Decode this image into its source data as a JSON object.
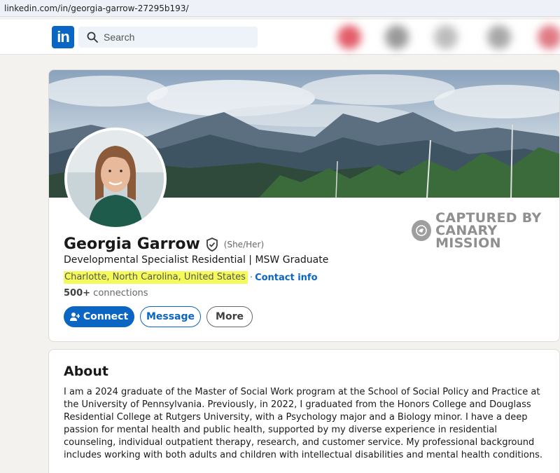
{
  "browser": {
    "url": "linkedin.com/in/georgia-garrow-27295b193/"
  },
  "nav": {
    "logo_text": "in",
    "search_placeholder": "Search"
  },
  "watermark": {
    "line1": "CAPTURED BY",
    "line2": "CANARY MISSION"
  },
  "profile": {
    "name": "Georgia Garrow",
    "pronouns": "(She/Her)",
    "headline": "Developmental Specialist Residential | MSW Graduate",
    "location": "Charlotte, North Carolina, United States",
    "separator": "·",
    "contact_label": "Contact info",
    "connections_count": "500+",
    "connections_label": "connections",
    "buttons": {
      "connect": "Connect",
      "message": "Message",
      "more": "More"
    }
  },
  "about": {
    "title": "About",
    "text": "I am a 2024 graduate of the Master of Social Work program at the School of Social Policy and Practice at the University of Pennsylvania. Previously, in 2022, I graduated from the Honors College and Douglass Residential College at Rutgers University, with a Psychology major and a Biology minor. I have a deep passion for mental health and public health, supported by my diverse experience in residential counseling, individual outpatient therapy, research, and customer service. My professional background includes working with both adults and children with intellectual disabilities and mental health conditions."
  },
  "colors": {
    "brand": "#0a66c2",
    "highlight": "#f3fa5a"
  }
}
